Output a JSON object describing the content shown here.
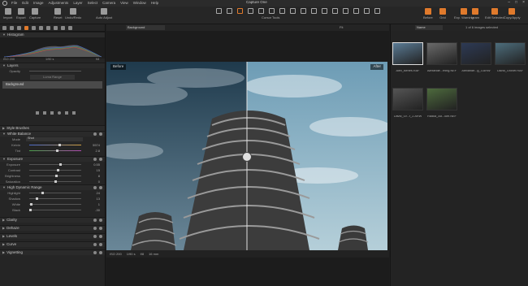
{
  "app": {
    "title": "Capture One"
  },
  "menu": [
    "File",
    "Edit",
    "Image",
    "Adjustments",
    "Layer",
    "Select",
    "Camera",
    "View",
    "Window",
    "Help"
  ],
  "toolbar": {
    "left": [
      {
        "label": "Import",
        "icon": "import-icon"
      },
      {
        "label": "Export",
        "icon": "export-icon"
      },
      {
        "label": "Capture",
        "icon": "camera-icon"
      },
      {
        "label": "Reset",
        "icon": "reset-icon"
      },
      {
        "label": "Undo/Redo",
        "icon": "undo-icon"
      },
      {
        "label": "Auto Adjust",
        "icon": "magic-wand-icon"
      }
    ],
    "cursor_tools_label": "Cursor Tools",
    "right": [
      {
        "label": "Before",
        "icon": "before-icon"
      },
      {
        "label": "Grid",
        "icon": "grid-icon"
      },
      {
        "label": "Exp. Warning",
        "icon": "warning-icon"
      },
      {
        "label": "Learn",
        "icon": "learn-icon"
      },
      {
        "label": "Edit Selected",
        "icon": "edit-icon"
      },
      {
        "label": "Copy/Apply",
        "icon": "copy-icon"
      }
    ]
  },
  "left_panel": {
    "histogram": {
      "title": "Histogram",
      "iso": "ISO 200",
      "shutter": "1/90 s",
      "aperture": "f/8"
    },
    "layers": {
      "title": "Layers",
      "opacity_label": "Opacity",
      "fill_label": "Luma Range",
      "background_label": "Background"
    },
    "style_brushes": {
      "title": "Style Brushes"
    },
    "white_balance": {
      "title": "White Balance",
      "mode_label": "Mode",
      "mode_value": "Shot",
      "kelvin_label": "Kelvin",
      "kelvin_value": "5574",
      "tint_label": "Tint",
      "tint_value": "2.8"
    },
    "exposure": {
      "title": "Exposure",
      "rows": [
        {
          "label": "Exposure",
          "value": "0.55",
          "pos": 0.6
        },
        {
          "label": "Contrast",
          "value": "15",
          "pos": 0.55
        },
        {
          "label": "Brightness",
          "value": "8",
          "pos": 0.52
        },
        {
          "label": "Saturation",
          "value": "0",
          "pos": 0.5
        }
      ]
    },
    "hdr": {
      "title": "High Dynamic Range",
      "rows": [
        {
          "label": "Highlight",
          "value": "24",
          "pos": 0.24
        },
        {
          "label": "Shadow",
          "value": "13",
          "pos": 0.13
        },
        {
          "label": "White",
          "value": "1",
          "pos": 0.01
        },
        {
          "label": "Black",
          "value": "-30",
          "pos": 0.0
        }
      ]
    },
    "bottom_sections": [
      "Clarity",
      "Dehaze",
      "Levels",
      "Curve",
      "Vignetting"
    ]
  },
  "viewer": {
    "collection": "Background",
    "fit": "Fit",
    "before_label": "Before",
    "after_label": "After",
    "filename": "Alex_Benes.RAF",
    "info": {
      "iso": "ISO 200",
      "shutter": "1/90 s",
      "aperture": "f/8",
      "focal": "16 mm"
    }
  },
  "browser": {
    "sort": "Name",
    "count": "1 of 6 images selected",
    "thumbs": [
      {
        "name": "Alex_Benes.RAF",
        "color": "#5a7b95",
        "selected": true
      },
      {
        "name": "Alexande...rning.NEF",
        "color": "#6a6a6a",
        "selected": false
      },
      {
        "name": "Alexande...g_3.ARW",
        "color": "#2d3a55",
        "selected": false
      },
      {
        "name": "David_Grover.RAF",
        "color": "#4d6d7c",
        "selected": false
      },
      {
        "name": "David_Gr...r_2.ARW",
        "color": "#555",
        "selected": false
      },
      {
        "name": "Radka_Ad...ium.NEF",
        "color": "#4d6a3d",
        "selected": false
      }
    ]
  }
}
